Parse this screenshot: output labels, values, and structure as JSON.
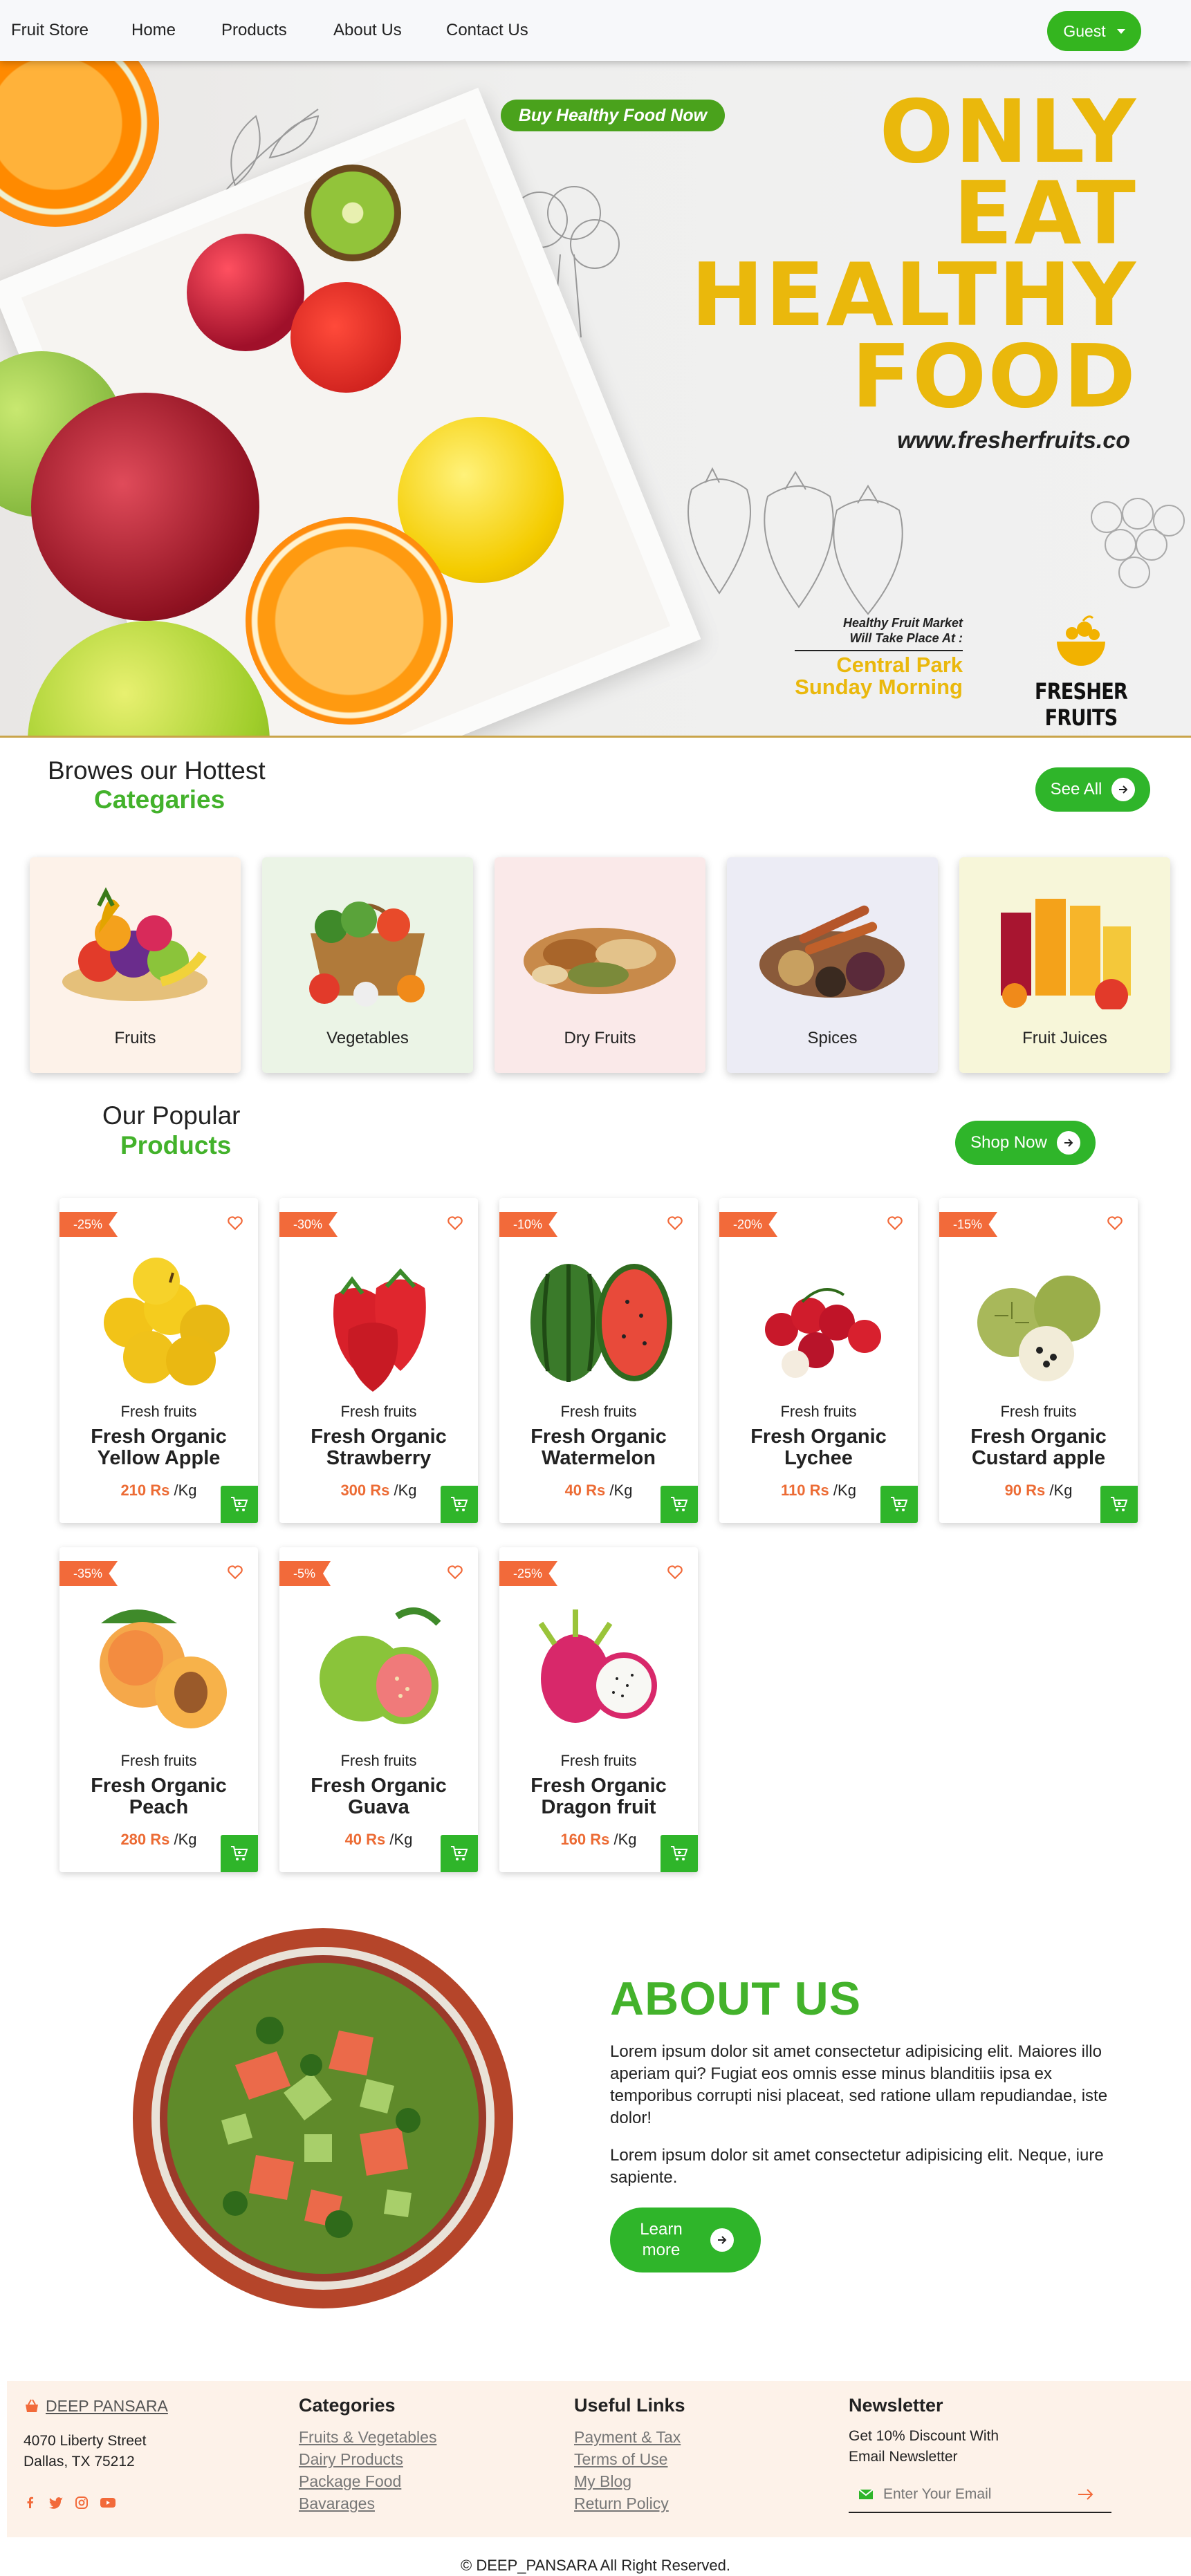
{
  "nav": {
    "brand": "Fruit Store",
    "links": [
      "Home",
      "Products",
      "About Us",
      "Contact Us"
    ],
    "user_label": "Guest"
  },
  "hero": {
    "pill": "Buy Healthy Food Now",
    "title_lines": [
      "ONLY",
      "EAT",
      "HEALTHY",
      "FOOD"
    ],
    "url": "www.fresherfruits.co",
    "market_line1": "Healthy Fruit Market",
    "market_line2": "Will Take Place At :",
    "place": "Central Park",
    "day": "Sunday Morning",
    "logo_text": "FRESHER FRUITS"
  },
  "categories": {
    "title": "Browes our Hottest",
    "subtitle": "Categaries",
    "button": "See All",
    "items": [
      {
        "label": "Fruits",
        "bg": "#fdf2e9"
      },
      {
        "label": "Vegetables",
        "bg": "#ebf4e6"
      },
      {
        "label": "Dry Fruits",
        "bg": "#fae9e9"
      },
      {
        "label": "Spices",
        "bg": "#ececf5"
      },
      {
        "label": "Fruit Juices",
        "bg": "#f7f6d9"
      }
    ]
  },
  "products": {
    "title": "Our Popular",
    "subtitle": "Products",
    "button": "Shop Now",
    "unit": "/Kg",
    "items": [
      {
        "discount": "-25%",
        "category": "Fresh fruits",
        "name_l1": "Fresh Organic",
        "name_l2": "Yellow Apple",
        "price": "210 Rs"
      },
      {
        "discount": "-30%",
        "category": "Fresh fruits",
        "name_l1": "Fresh Organic",
        "name_l2": "Strawberry",
        "price": "300 Rs"
      },
      {
        "discount": "-10%",
        "category": "Fresh fruits",
        "name_l1": "Fresh Organic",
        "name_l2": "Watermelon",
        "price": "40 Rs"
      },
      {
        "discount": "-20%",
        "category": "Fresh fruits",
        "name_l1": "Fresh Organic",
        "name_l2": "Lychee",
        "price": "110 Rs"
      },
      {
        "discount": "-15%",
        "category": "Fresh fruits",
        "name_l1": "Fresh Organic",
        "name_l2": "Custard apple",
        "price": "90 Rs"
      },
      {
        "discount": "-35%",
        "category": "Fresh fruits",
        "name_l1": "Fresh Organic",
        "name_l2": "Peach",
        "price": "280 Rs"
      },
      {
        "discount": "-5%",
        "category": "Fresh fruits",
        "name_l1": "Fresh Organic",
        "name_l2": "Guava",
        "price": "40 Rs"
      },
      {
        "discount": "-25%",
        "category": "Fresh fruits",
        "name_l1": "Fresh Organic",
        "name_l2": "Dragon fruit",
        "price": "160 Rs"
      }
    ]
  },
  "about": {
    "title": "ABOUT US",
    "p1": "Lorem ipsum dolor sit amet consectetur adipisicing elit. Maiores illo aperiam qui? Fugiat eos omnis esse minus blanditiis ipsa ex temporibus corrupti nisi placeat, sed ratione ullam repudiandae, iste dolor!",
    "p2": "Lorem ipsum dolor sit amet consectetur adipisicing elit. Neque, iure sapiente.",
    "button": "Learn more"
  },
  "footer": {
    "brand": "DEEP PANSARA",
    "address1": "4070 Liberty Street",
    "address2": "Dallas, TX 75212",
    "social_icons": [
      "facebook-icon",
      "twitter-icon",
      "instagram-icon",
      "youtube-icon"
    ],
    "categories_title": "Categories",
    "categories": [
      "Fruits & Vegetables",
      "Dairy Products",
      "Package Food",
      "Bavarages"
    ],
    "links_title": "Useful Links",
    "links": [
      "Payment & Tax",
      "Terms of Use",
      "My Blog",
      "Return Policy"
    ],
    "newsletter_title": "Newsletter",
    "newsletter_text": "Get 10% Discount With Email Newsletter",
    "email_placeholder": "Enter Your Email",
    "copyright": "© DEEP_PANSARA All Right Reserved."
  },
  "colors": {
    "brand_green": "#2fb52a",
    "heading_green": "#43b22b",
    "accent_orange": "#f26a3a",
    "hero_yellow": "#eab80c"
  }
}
